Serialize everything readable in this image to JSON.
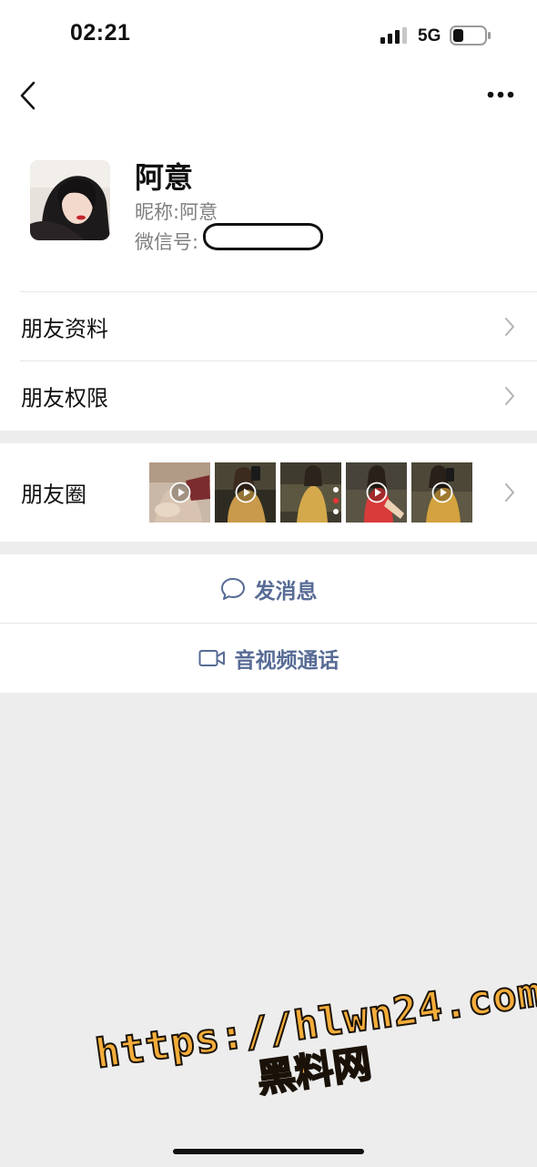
{
  "status_bar": {
    "time": "02:21",
    "network": "5G"
  },
  "nav": {
    "back_icon": "chevron-left-icon",
    "more_icon": "more-icon"
  },
  "profile": {
    "display_name": "阿意",
    "nickname_label": "昵称:",
    "nickname_value": "阿意",
    "wechat_id_label": "微信号:"
  },
  "menu": {
    "friend_info_label": "朋友资料",
    "friend_permissions_label": "朋友权限",
    "moments_label": "朋友圈"
  },
  "moments": {
    "thumbnails": [
      {
        "has_play": true
      },
      {
        "has_play": true
      },
      {
        "has_play": false
      },
      {
        "has_play": true
      },
      {
        "has_play": true
      }
    ]
  },
  "actions": {
    "send_message_label": "发消息",
    "video_call_label": "音视频通话"
  },
  "watermark": {
    "line1": "https://hlwn24.com",
    "line2": "黑料网"
  },
  "colors": {
    "link_blue": "#576b95",
    "watermark_orange": "#f4ad3a"
  }
}
